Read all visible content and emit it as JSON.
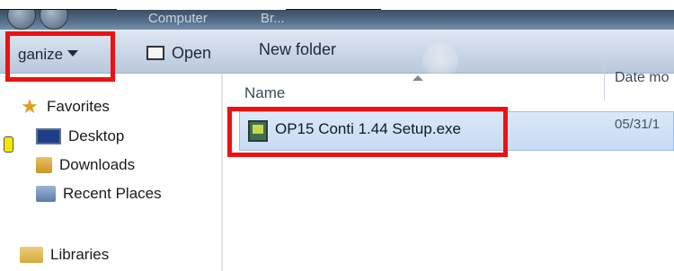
{
  "address_bar": {
    "crumbs": [
      "Computer",
      "Br..."
    ]
  },
  "toolbar": {
    "organize_label": "ganize",
    "open_label": "Open",
    "new_folder_label": "New folder"
  },
  "nav_pane": {
    "favorites_label": "Favorites",
    "items": [
      {
        "label": "Desktop",
        "icon": "desktop-icon"
      },
      {
        "label": "Downloads",
        "icon": "downloads-folder-icon"
      },
      {
        "label": "Recent Places",
        "icon": "recent-places-icon"
      }
    ],
    "libraries_label": "Libraries"
  },
  "file_list": {
    "columns": {
      "name": "Name",
      "date": "Date mo"
    },
    "rows": [
      {
        "name": "OP15 Conti 1.44 Setup.exe",
        "date": "05/31/1"
      }
    ]
  },
  "annotation_color": "#ee1111"
}
